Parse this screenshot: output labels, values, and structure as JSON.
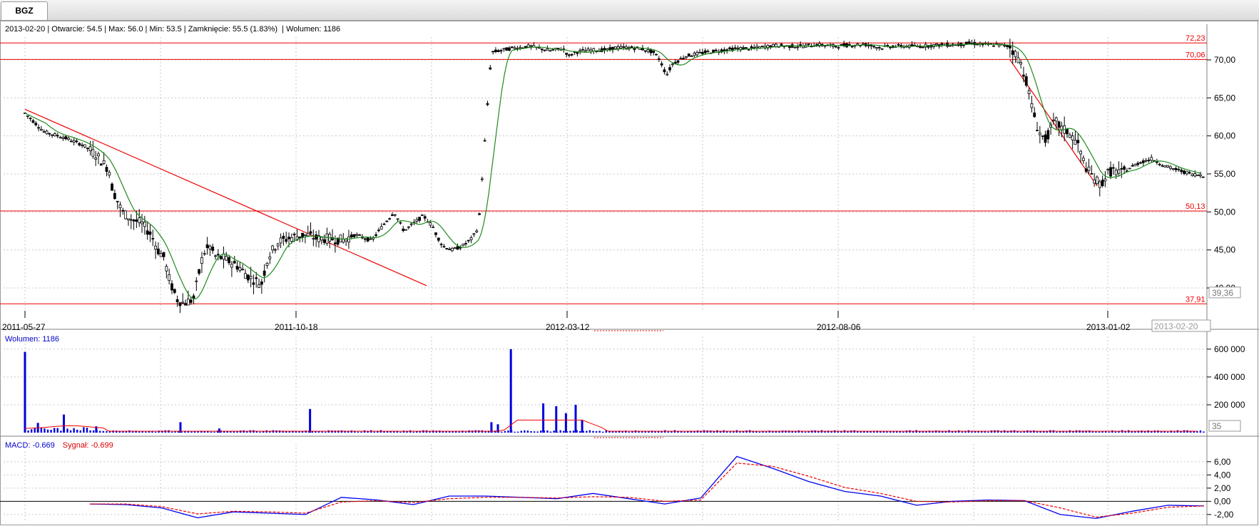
{
  "tab": {
    "label": "BGZ"
  },
  "info": {
    "date": "2013-02-20",
    "open": "Otwarcie: 54.5",
    "max": "Max: 56.0",
    "min": "Min: 53.5",
    "close": "Zamknięcie: 55.5 (1.83%)",
    "volume": "Wolumen: 1186"
  },
  "volume_label": "Wolumen: 1186",
  "macd_label": {
    "macd": "MACD: -0.669",
    "signal": "Sygnał: -0.699"
  },
  "price_tag": "39,36",
  "date_tag": "2013-02-20",
  "volume_tag": "35",
  "colors": {
    "candle": "#000000",
    "ma": "#1f8a1f",
    "levels": "#ee0000",
    "volume": "#0000dd",
    "volume_ma": "#ee0000",
    "macd": "#0000ee",
    "signal": "#ee0000",
    "grid": "#c8c8c8"
  },
  "chart_data": [
    {
      "type": "candlestick",
      "name": "price",
      "x_ticks": [
        "2011-05-27",
        "2011-10-18",
        "2012-03-12",
        "2012-08-06",
        "2013-01-02"
      ],
      "y_ticks": [
        "70,00",
        "65,00",
        "60,00",
        "55,00",
        "50,00",
        "45,00",
        "40,00"
      ],
      "ylim": [
        37,
        73
      ],
      "level_labels": [
        "72,23",
        "70,06",
        "50,13",
        "37,91"
      ],
      "levels": [
        72.23,
        70.06,
        50.13,
        37.91
      ],
      "series": [
        {
          "x": [
            0,
            0.03,
            0.06,
            0.09,
            0.11,
            0.115,
            0.12,
            0.13,
            0.135,
            0.15,
            0.165,
            0.18,
            0.195,
            0.205,
            0.215,
            0.22,
            0.225,
            0.23,
            0.235,
            0.245,
            0.26,
            0.275,
            0.285,
            0.295,
            0.305,
            0.315,
            0.33,
            0.345,
            0.355,
            0.365,
            0.375,
            0.39,
            0.405,
            0.42,
            0.435,
            0.45,
            0.47,
            0.49,
            0.51,
            0.535,
            0.555,
            0.57,
            0.585,
            0.6,
            0.615,
            0.62,
            0.625,
            0.63,
            0.635,
            0.645,
            0.66,
            0.675,
            0.69,
            0.7,
            0.72,
            0.75,
            0.78,
            0.81,
            0.83,
            0.84,
            0.845,
            0.85,
            0.86,
            0.88,
            0.9,
            0.91,
            0.93,
            0.95,
            0.97,
            0.98,
            0.99,
            1.0,
            1.01,
            1.02,
            1.05,
            1.08,
            1.1,
            1.12,
            1.14,
            1.16,
            1.18,
            1.2,
            1.22,
            1.25,
            1.28,
            1.3,
            1.32,
            1.34,
            1.36,
            1.38,
            1.4,
            1.42,
            1.44,
            1.46,
            1.48,
            1.5,
            1.52,
            1.535,
            1.545,
            1.555,
            1.565,
            1.575,
            1.59,
            1.6,
            1.61,
            1.62,
            1.625,
            1.63,
            1.64,
            1.65,
            1.66,
            1.67,
            1.68,
            1.69,
            1.7,
            1.72,
            1.74,
            1.76,
            1.78,
            1.8,
            1.82
          ],
          "y": [
            63.0,
            60.5,
            59.8,
            58.8,
            57.5,
            57.0,
            56.5,
            55.5,
            53.0,
            50.0,
            49.0,
            48.5,
            47.0,
            45.0,
            44.0,
            42.0,
            40.5,
            39.5,
            38.5,
            38.0,
            38.5,
            44.5,
            45.5,
            44.0,
            44.0,
            43.5,
            42.8,
            41.5,
            41.0,
            40.5,
            44.0,
            46.0,
            46.5,
            46.8,
            47.0,
            46.5,
            46.5,
            46.3,
            47.0,
            46.2,
            48.5,
            50.0,
            47.5,
            48.5,
            49.5,
            49.0,
            48.5,
            48.0,
            47.0,
            45.5,
            45.0,
            45.5,
            46.5,
            48.0,
            71.0,
            71.5,
            71.8,
            71.2,
            71.5,
            70.5,
            70.8,
            71.0,
            71.2,
            71.3,
            71.3,
            71.6,
            71.6,
            71.5,
            71.0,
            70.0,
            68.0,
            69.5,
            70.0,
            70.5,
            71.0,
            71.3,
            71.5,
            71.5,
            71.7,
            71.9,
            71.8,
            71.8,
            72.0,
            71.8,
            72.0,
            72.0,
            71.6,
            71.8,
            71.8,
            71.8,
            71.9,
            72.0,
            72.0,
            72.2,
            72.0,
            72.0,
            71.8,
            70.0,
            67.5,
            63.5,
            60.5,
            59.5,
            62.0,
            61.0,
            60.5,
            59.5,
            59.0,
            57.5,
            55.5,
            54.5,
            53.5,
            55.0,
            55.5,
            55.0,
            55.5,
            56.5,
            57.0,
            56.0,
            55.5,
            55.0,
            54.8
          ]
        }
      ]
    },
    {
      "type": "bar",
      "name": "volume",
      "y_ticks": [
        "600 000",
        "400 000",
        "200 000"
      ],
      "ylim": [
        0,
        630000
      ],
      "series": [
        {
          "x": [
            0.0,
            0.02,
            0.06,
            0.11,
            0.24,
            0.3,
            0.44,
            0.72,
            0.73,
            0.75,
            0.8,
            0.82,
            0.835,
            0.85,
            0.86
          ],
          "values": [
            580000,
            70000,
            130000,
            45000,
            75000,
            30000,
            170000,
            75000,
            60000,
            600000,
            210000,
            190000,
            140000,
            200000,
            90000
          ]
        }
      ]
    },
    {
      "type": "line",
      "name": "macd",
      "y_ticks": [
        "6,00",
        "4,00",
        "2,00",
        "0,00",
        "-2,00"
      ],
      "ylim": [
        -3.2,
        7.6
      ],
      "series": [
        {
          "values": [
            -0.4,
            -0.5,
            -1.0,
            -2.5,
            -1.6,
            -1.8,
            -2.0,
            0.6,
            0.2,
            -0.5,
            0.8,
            0.8,
            0.6,
            0.4,
            1.2,
            0.4,
            -0.4,
            0.5,
            6.8,
            5.0,
            3.0,
            1.5,
            0.8,
            -0.6,
            0.0,
            0.2,
            0.1,
            -2.0,
            -2.6,
            -1.5,
            -0.6,
            -0.7
          ]
        },
        {
          "values": [
            -0.4,
            -0.4,
            -0.8,
            -1.9,
            -1.5,
            -1.6,
            -1.8,
            -0.1,
            0.1,
            -0.2,
            0.4,
            0.6,
            0.6,
            0.5,
            0.7,
            0.6,
            0.0,
            0.2,
            5.8,
            5.3,
            3.8,
            2.1,
            1.2,
            0.0,
            -0.1,
            0.1,
            0.1,
            -1.0,
            -2.4,
            -1.8,
            -0.9,
            -0.7
          ]
        }
      ]
    }
  ]
}
